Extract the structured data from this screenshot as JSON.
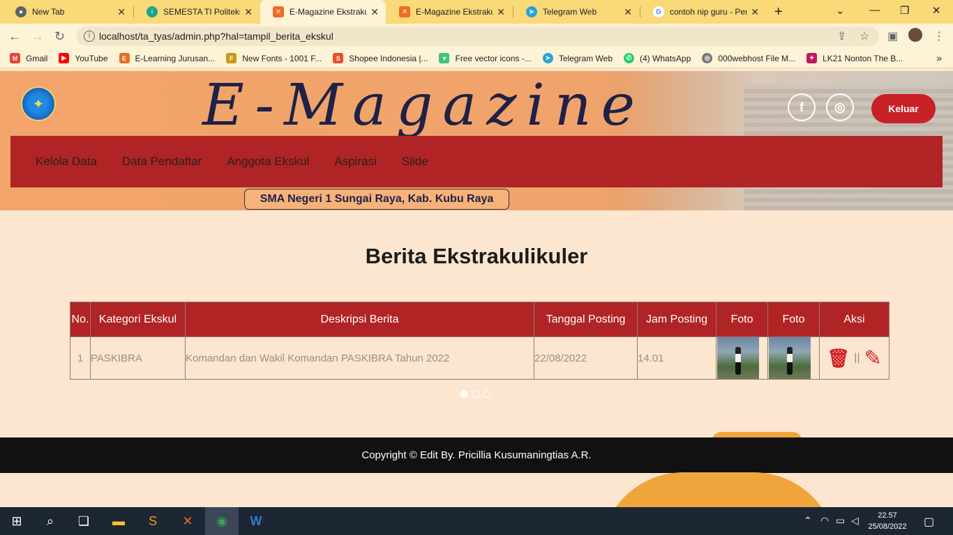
{
  "browser": {
    "tabs": [
      {
        "title": "New Tab",
        "icon": "chrome-icon",
        "color": "#5f6368"
      },
      {
        "title": "SEMESTA TI Politeknik",
        "icon": "semesta-icon",
        "color": "#1aa58c"
      },
      {
        "title": "E-Magazine Ekstrakuli",
        "icon": "xampp-icon",
        "color": "#f06b24",
        "active": true
      },
      {
        "title": "E-Magazine Ekstrakuli",
        "icon": "xampp-icon",
        "color": "#f06b24"
      },
      {
        "title": "Telegram Web",
        "icon": "telegram-icon",
        "color": "#2aa1da"
      },
      {
        "title": "contoh nip guru - Pen",
        "icon": "google-icon",
        "color": "#4285f4"
      }
    ],
    "url": "localhost/ta_tyas/admin.php?hal=tampil_berita_ekskul",
    "bookmarks": [
      {
        "label": "Gmail",
        "icon": "gmail-icon",
        "color": "#ea4335"
      },
      {
        "label": "YouTube",
        "icon": "youtube-icon",
        "color": "#ff0000"
      },
      {
        "label": "E-Learning Jurusan...",
        "icon": "elearning-icon",
        "color": "#e86c1f"
      },
      {
        "label": "New Fonts - 1001 F...",
        "icon": "fonts-icon",
        "color": "#c49a18"
      },
      {
        "label": "Shopee Indonesia |...",
        "icon": "shopee-icon",
        "color": "#ee4d2d"
      },
      {
        "label": "Free vector icons -...",
        "icon": "flaticon-icon",
        "color": "#3fc37a"
      },
      {
        "label": "Telegram Web",
        "icon": "telegram-icon",
        "color": "#2aa1da"
      },
      {
        "label": "(4) WhatsApp",
        "icon": "whatsapp-icon",
        "color": "#25d366"
      },
      {
        "label": "000webhost File M...",
        "icon": "webhost-icon",
        "color": "#777777"
      },
      {
        "label": "LK21 Nonton The B...",
        "icon": "lk21-icon",
        "color": "#c2185b"
      }
    ]
  },
  "site": {
    "brand": "E-Magazine",
    "logout_label": "Keluar",
    "school": "SMA Negeri 1 Sungai Raya, Kab. Kubu Raya",
    "menu": [
      "Kelola Data",
      "Data Pendaftar",
      "Anggota Ekskul",
      "Aspirasi",
      "Slide"
    ]
  },
  "main": {
    "title": "Berita Ekstrakulikuler",
    "table": {
      "headers": [
        "No.",
        "Kategori Ekskul",
        "Deskripsi Berita",
        "Tanggal Posting",
        "Jam Posting",
        "Foto",
        "Foto",
        "Aksi"
      ],
      "rows": [
        {
          "no": "1",
          "kategori": "PASKIBRA",
          "deskripsi": "Komandan dan Wakil Komandan PASKIBRA Tahun 2022",
          "tanggal": "22/08/2022",
          "jam": "14.01",
          "separator": "||"
        }
      ]
    },
    "carousel": {
      "count": 3,
      "active_index": 0
    }
  },
  "footer": {
    "text": "Copyright © Edit By. Pricillia Kusumaningtias A.R."
  },
  "taskbar": {
    "time": "22.57",
    "date": "25/08/2022"
  },
  "colors": {
    "nav_red": "#b02425",
    "logout_red": "#c82127",
    "hero_orange": "#f2a46a",
    "page_bg": "#fce6cf"
  }
}
